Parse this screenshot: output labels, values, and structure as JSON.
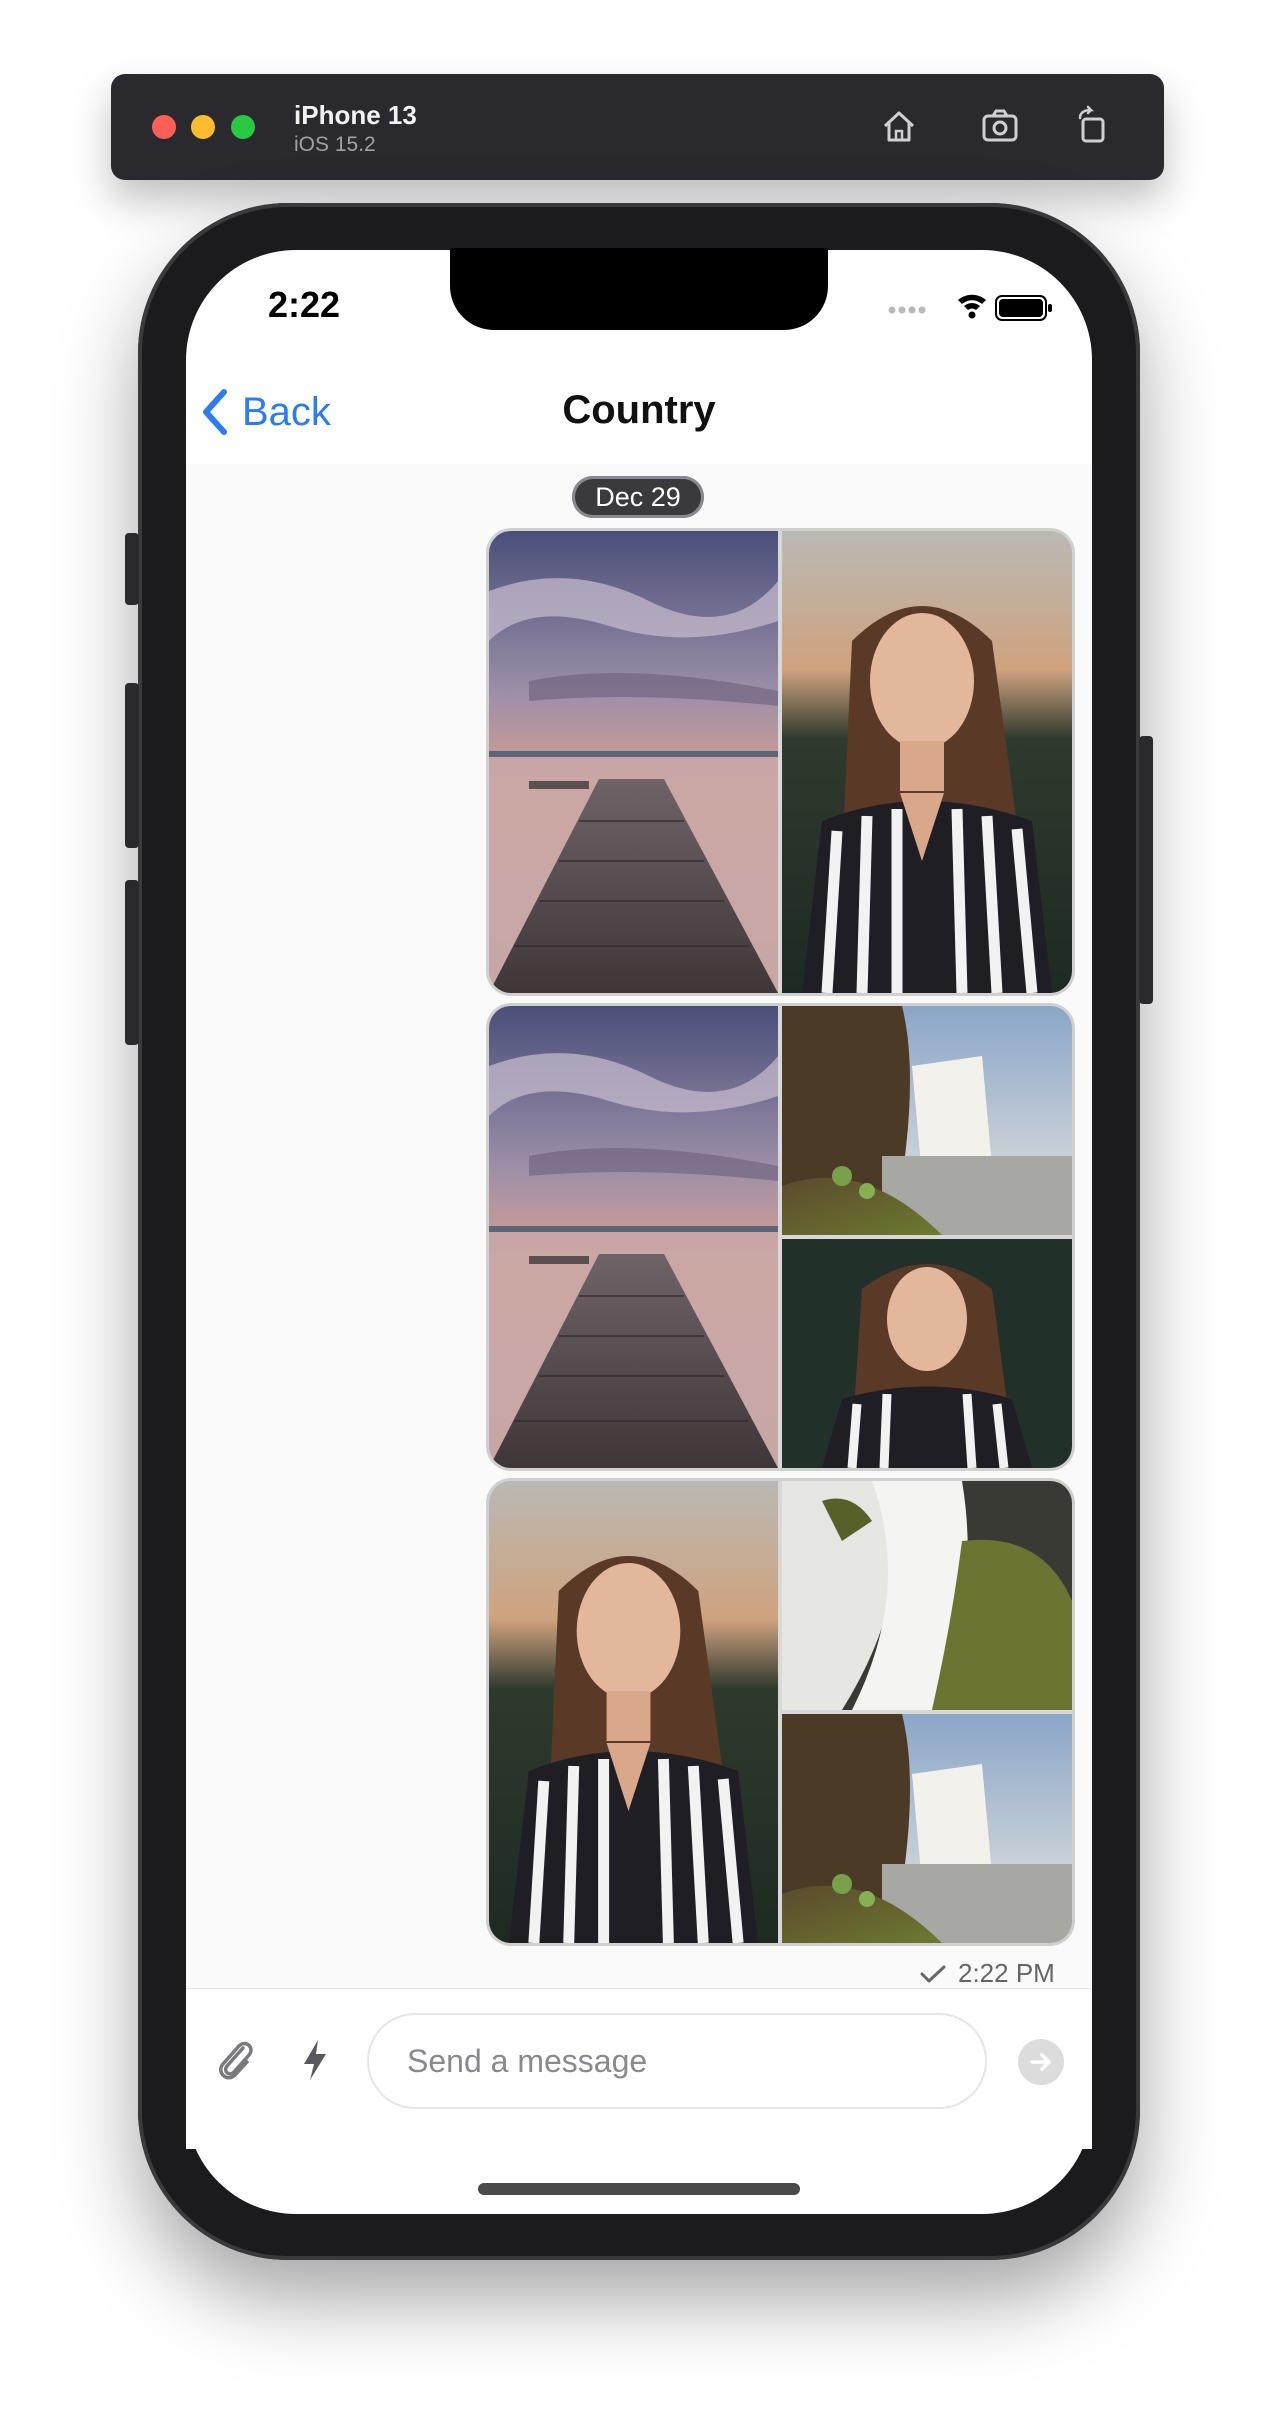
{
  "simulator": {
    "device": "iPhone 13",
    "os": "iOS 15.2",
    "icons": [
      "home-icon",
      "screenshot-icon",
      "rotate-icon"
    ]
  },
  "status_bar": {
    "time": "2:22"
  },
  "nav": {
    "back_label": "Back",
    "title": "Country"
  },
  "chat": {
    "date_separator": "Dec 29",
    "messages": [
      {
        "layout": "two-columns",
        "images": [
          "pier-sunset",
          "portrait-woman"
        ]
      },
      {
        "layout": "left-tall-right-stack",
        "images": [
          "pier-sunset",
          "waterfall-cliff",
          "portrait-woman"
        ]
      },
      {
        "layout": "left-tall-right-stack",
        "images": [
          "portrait-woman",
          "waterfall-closeup",
          "waterfall-cliff"
        ]
      }
    ],
    "last_message_time": "2:22 PM",
    "delivery_status": "sent"
  },
  "composer": {
    "placeholder": "Send a message",
    "value": ""
  },
  "colors": {
    "accent": "#2d7cf6"
  }
}
